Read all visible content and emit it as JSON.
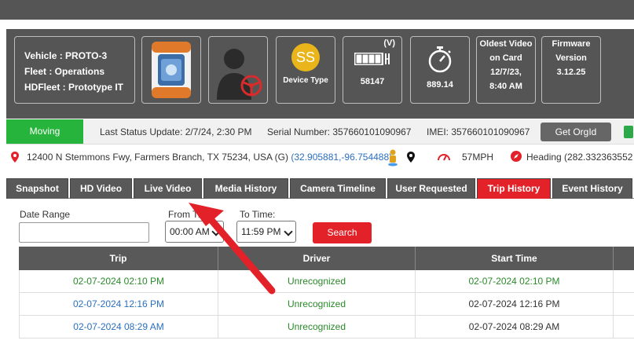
{
  "header": {
    "vehicle_line": "Vehicle : PROTO-3",
    "fleet_line": "Fleet : Operations",
    "hdfleet_line": "HDFleet : Prototype IT",
    "device_initials": "SS",
    "device_label": "Device Type",
    "odometer_unit": "(V)",
    "odometer_value": "58147",
    "timer_value": "889.14",
    "oldest_video": [
      "Oldest Video",
      "on Card",
      "12/7/23,",
      "8:40 AM"
    ],
    "firmware": [
      "Firmware",
      "Version",
      "3.12.25"
    ]
  },
  "status": {
    "moving": "Moving",
    "last_update": "Last Status Update: 2/7/24, 2:30 PM",
    "serial": "Serial Number: 357660101090967",
    "imei": "IMEI: 357660101090967",
    "orgid_button": "Get OrgId"
  },
  "location": {
    "address": "12400 N Stemmons Fwy, Farmers Branch, TX 75234, USA (G)",
    "coords": "(32.905881,-96.754488)",
    "speed": "57MPH",
    "heading": "Heading (282.332363552"
  },
  "tabs": [
    "Snapshot",
    "HD Video",
    "Live Video",
    "Media History",
    "Camera Timeline",
    "User Requested",
    "Trip History",
    "Event History"
  ],
  "filters": {
    "date_range_label": "Date Range",
    "from_time_label": "From Time:",
    "from_time_value": "00:00 AM",
    "to_time_label": "To Time:",
    "to_time_value": "11:59 PM",
    "search_button": "Search"
  },
  "table": {
    "headers": [
      "Trip",
      "Driver",
      "Start Time"
    ],
    "rows": [
      {
        "trip": "02-07-2024 02:10 PM",
        "driver": "Unrecognized",
        "start": "02-07-2024 02:10 PM"
      },
      {
        "trip": "02-07-2024 12:16 PM",
        "driver": "Unrecognized",
        "start": "02-07-2024 12:16 PM"
      },
      {
        "trip": "02-07-2024 08:29 AM",
        "driver": "Unrecognized",
        "start": "02-07-2024 08:29 AM"
      }
    ]
  },
  "colors": {
    "accent_red": "#e32129",
    "moving_green": "#27b43c",
    "panel_gray": "#555555",
    "link_blue": "#2a6fbf"
  }
}
